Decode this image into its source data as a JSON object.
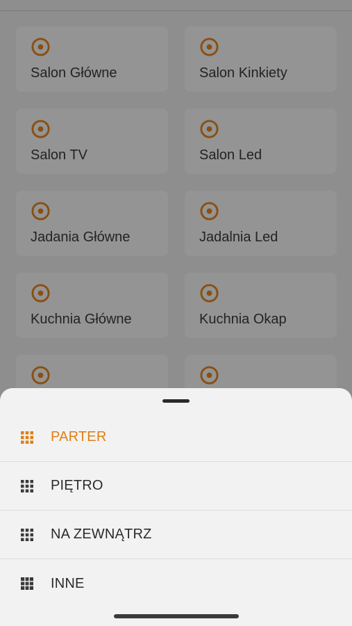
{
  "colors": {
    "accent": "#df7f13",
    "icon_dimmed": "#8a4f12",
    "overlay_bg": "#8e8e8e",
    "sheet_bg": "#f2f2f2"
  },
  "lights": [
    {
      "label": "Salon Główne",
      "icon": "radio-target-icon"
    },
    {
      "label": "Salon Kinkiety",
      "icon": "radio-target-icon"
    },
    {
      "label": "Salon TV",
      "icon": "radio-target-icon"
    },
    {
      "label": "Salon Led",
      "icon": "radio-target-icon"
    },
    {
      "label": "Jadania Główne",
      "icon": "radio-target-icon"
    },
    {
      "label": "Jadalnia Led",
      "icon": "radio-target-icon"
    },
    {
      "label": "Kuchnia Główne",
      "icon": "radio-target-icon"
    },
    {
      "label": "Kuchnia Okap",
      "icon": "radio-target-icon"
    },
    {
      "label": "",
      "icon": "radio-target-icon"
    },
    {
      "label": "",
      "icon": "radio-target-icon"
    }
  ],
  "sheet": {
    "items": [
      {
        "label": "PARTER",
        "icon": "grid-dots-icon",
        "active": true
      },
      {
        "label": "PIĘTRO",
        "icon": "grid-dots-icon",
        "active": false
      },
      {
        "label": "NA ZEWNĄTRZ",
        "icon": "grid-dots-icon",
        "active": false
      },
      {
        "label": "INNE",
        "icon": "grid-square-icon",
        "active": false
      }
    ]
  }
}
